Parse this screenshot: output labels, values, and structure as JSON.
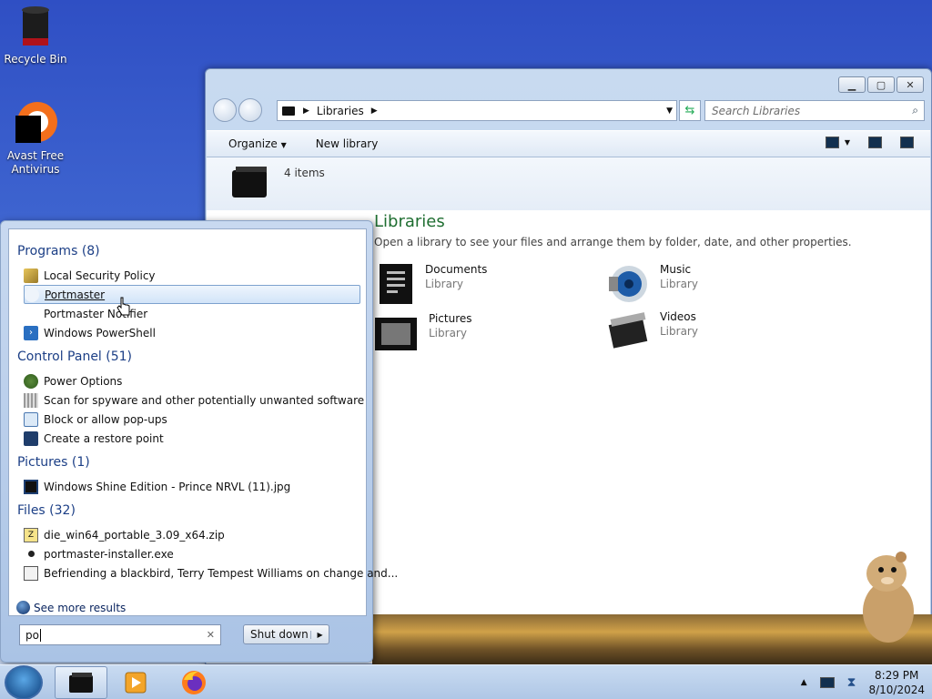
{
  "desktop": {
    "icons": [
      {
        "label": "Recycle Bin",
        "icon": "recycle-bin-icon"
      },
      {
        "label": "Avast Free Antivirus",
        "icon": "avast-icon"
      }
    ]
  },
  "explorer": {
    "address": {
      "root_icon": "libraries-icon",
      "path": "Libraries"
    },
    "search_placeholder": "Search Libraries",
    "toolbar": {
      "organize_label": "Organize",
      "new_library_label": "New library"
    },
    "item_count": "4 items",
    "heading": "Libraries",
    "subheading": "Open a library to see your files and arrange them by folder, date, and other properties.",
    "libraries": [
      {
        "name": "Documents",
        "type": "Library",
        "icon": "documents-icon"
      },
      {
        "name": "Music",
        "type": "Library",
        "icon": "music-icon"
      },
      {
        "name": "Pictures",
        "type": "Library",
        "icon": "pictures-icon"
      },
      {
        "name": "Videos",
        "type": "Library",
        "icon": "videos-icon"
      }
    ]
  },
  "start_menu": {
    "groups": [
      {
        "title": "Programs (8)",
        "items": [
          "Local Security Policy",
          "Portmaster",
          "Portmaster Notifier",
          "Windows PowerShell"
        ]
      },
      {
        "title": "Control Panel (51)",
        "items": [
          "Power Options",
          "Scan for spyware and other potentially unwanted software",
          "Block or allow pop-ups",
          "Create a restore point"
        ]
      },
      {
        "title": "Pictures (1)",
        "items": [
          "Windows Shine Edition - Prince NRVL (11).jpg"
        ]
      },
      {
        "title": "Files (32)",
        "items": [
          "die_win64_portable_3.09_x64.zip",
          "portmaster-installer.exe",
          "Befriending a blackbird, Terry Tempest Williams on change and..."
        ]
      }
    ],
    "selected_item": "Portmaster",
    "see_more": "See more results",
    "search_value": "po",
    "shutdown_label": "Shut down"
  },
  "taskbar": {
    "clock_time": "8:29 PM",
    "clock_date": "8/10/2024"
  },
  "colors": {
    "accent_heading": "#1f6e31",
    "group_title": "#1c3f86"
  }
}
